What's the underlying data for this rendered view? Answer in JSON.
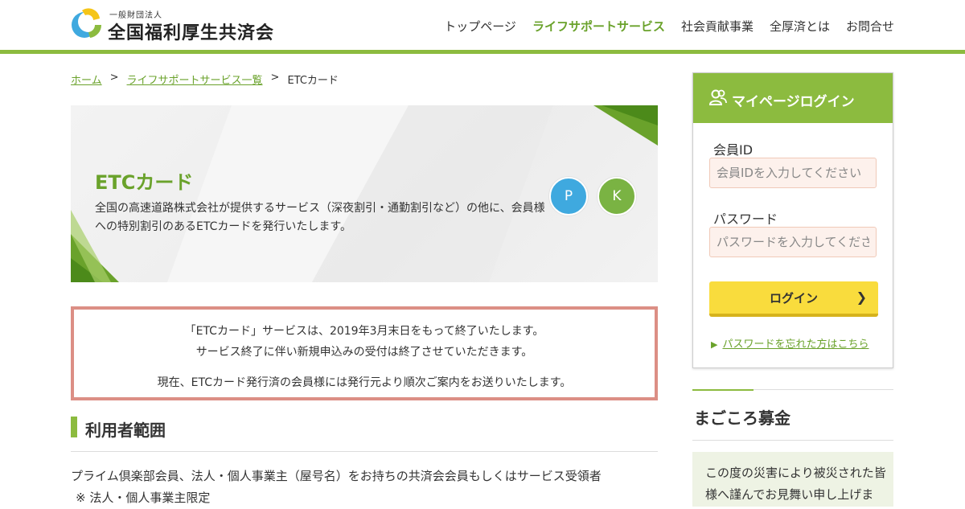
{
  "header": {
    "logo_sub": "一般財団法人",
    "logo_name": "全国福利厚生共済会",
    "nav": [
      {
        "label": "トップページ",
        "active": false
      },
      {
        "label": "ライフサポートサービス",
        "active": true
      },
      {
        "label": "社会貢献事業",
        "active": false
      },
      {
        "label": "全厚済とは",
        "active": false
      },
      {
        "label": "お問合せ",
        "active": false
      }
    ]
  },
  "breadcrumb": {
    "home": "ホーム",
    "sep": ">",
    "list": "ライフサポートサービス一覧",
    "current": "ETCカード"
  },
  "hero": {
    "title": "ETCカード",
    "description": "全国の高速道路株式会社が提供するサービス（深夜割引・通勤割引など）の他に、会員様への特別割引のあるETCカードを発行いたします。",
    "badge_p": "P",
    "badge_k": "K"
  },
  "notice": {
    "line1": "「ETCカード」サービスは、2019年3月末日をもって終了いたします。",
    "line2": "サービス終了に伴い新規申込みの受付は終了させていただきます。",
    "line3": "現在、ETCカード発行済の会員様には発行元より順次ご案内をお送りいたします。"
  },
  "section": {
    "title": "利用者範囲",
    "body1": "プライム倶楽部会員、法人・個人事業主（屋号名）をお持ちの共済会会員もしくはサービス受領者",
    "body2": "※ 法人・個人事業主限定"
  },
  "login": {
    "title": "マイページログイン",
    "id_label": "会員ID",
    "id_placeholder": "会員IDを入力してください",
    "pw_label": "パスワード",
    "pw_placeholder": "パスワードを入力してください",
    "button": "ログイン",
    "forgot": "パスワードを忘れた方はこちら"
  },
  "magokoro": {
    "title": "まごころ募金",
    "text": "この度の災害により被災された皆様へ謹んでお見舞い申し上げます。"
  },
  "colors": {
    "accent": "#8cbb3f",
    "link": "#6aa22b",
    "notice_border": "#dc8f85",
    "button": "#f9dc3d",
    "badge_p": "#3fa9df",
    "badge_k": "#7ab343"
  }
}
